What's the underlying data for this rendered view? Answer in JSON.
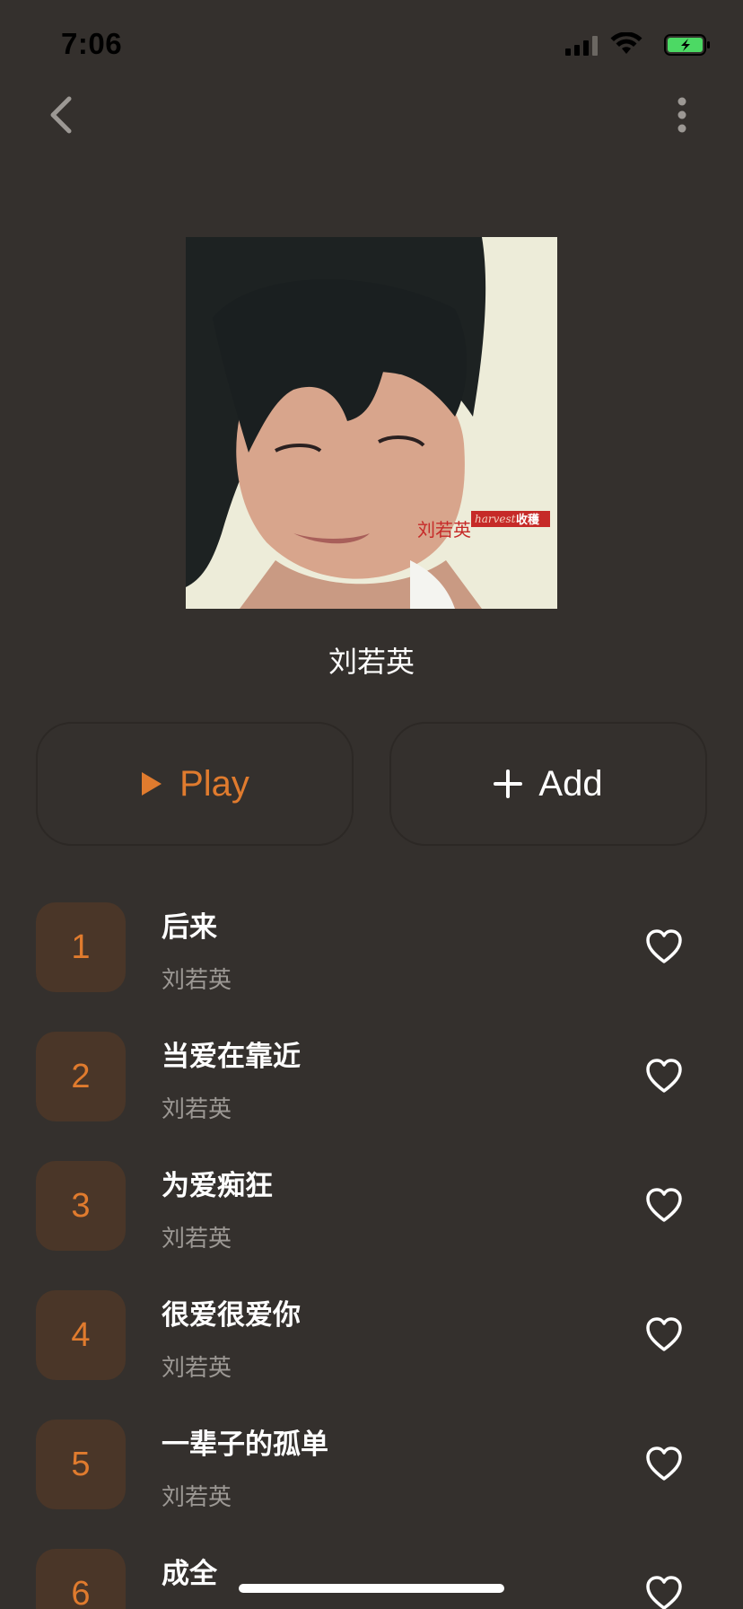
{
  "status_bar": {
    "time": "7:06",
    "icons": [
      "signal-icon",
      "wifi-icon",
      "battery-icon"
    ],
    "battery_color": "#4cd964"
  },
  "nav": {
    "back_icon": "chevron-left-icon",
    "more_icon": "more-vertical-icon"
  },
  "album": {
    "title": "刘若英",
    "cover_text": {
      "artist": "刘若英",
      "label": "harvest",
      "label_cn": "收穫"
    }
  },
  "actions": {
    "play_label": "Play",
    "add_label": "Add",
    "accent_color": "#e07b2e"
  },
  "tracks": [
    {
      "num": "1",
      "title": "后来",
      "artist": "刘若英"
    },
    {
      "num": "2",
      "title": "当爱在靠近",
      "artist": "刘若英"
    },
    {
      "num": "3",
      "title": "为爱痴狂",
      "artist": "刘若英"
    },
    {
      "num": "4",
      "title": "很爱很爱你",
      "artist": "刘若英"
    },
    {
      "num": "5",
      "title": "一辈子的孤单",
      "artist": "刘若英"
    },
    {
      "num": "6",
      "title": "成全",
      "artist": ""
    }
  ]
}
